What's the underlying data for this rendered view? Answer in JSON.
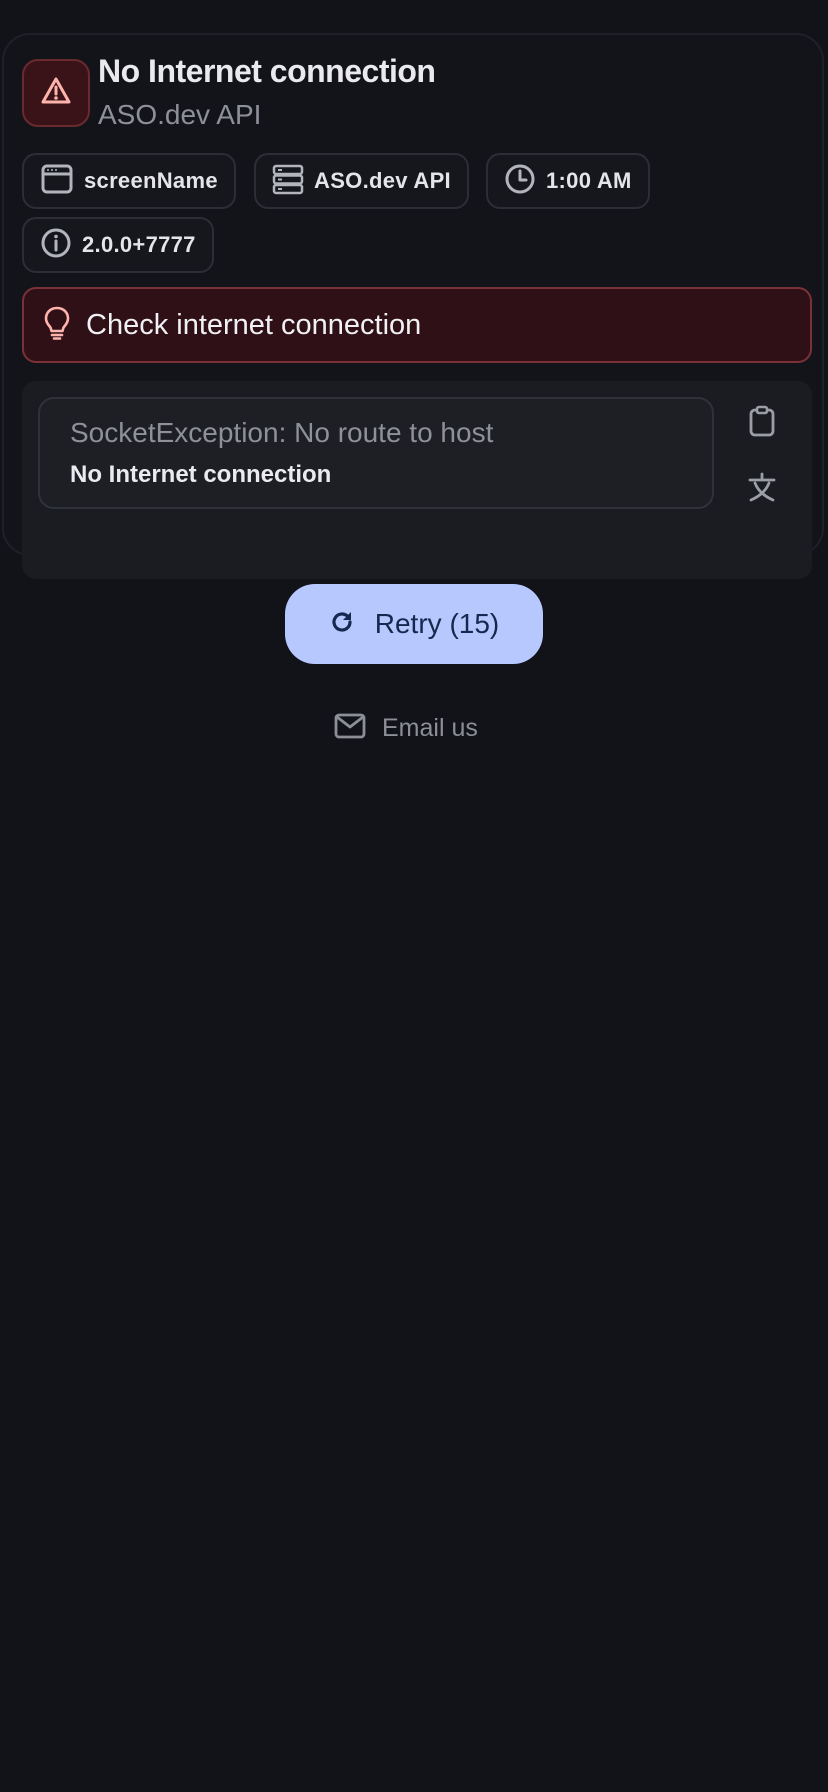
{
  "error_card": {
    "title": "No Internet connection",
    "subtitle": "ASO.dev API",
    "warning_icon": "warning-triangle-icon",
    "chips": [
      {
        "icon": "window-icon",
        "label": "screenName"
      },
      {
        "icon": "server-icon",
        "label": "ASO.dev API"
      },
      {
        "icon": "clock-icon",
        "label": "1:00 AM"
      },
      {
        "icon": "info-icon",
        "label": "2.0.0+7777"
      }
    ],
    "hint": {
      "icon": "lightbulb-icon",
      "label": "Check internet connection"
    },
    "details": {
      "type_text": "SocketException: No route to host",
      "message": "No Internet connection",
      "copy_icon": "clipboard-icon",
      "translate_icon": "translate-icon"
    }
  },
  "actions": {
    "retry_label": "Retry (15)",
    "retry_icon": "refresh-icon",
    "email_label": "Email us",
    "email_icon": "mail-icon"
  },
  "colors": {
    "background": "#111318",
    "hint_background": "#2e1016",
    "hint_border": "#7a3238",
    "warning_accent": "#ffb4ab",
    "retry_background": "#b7c8ff",
    "retry_text": "#15284f"
  }
}
